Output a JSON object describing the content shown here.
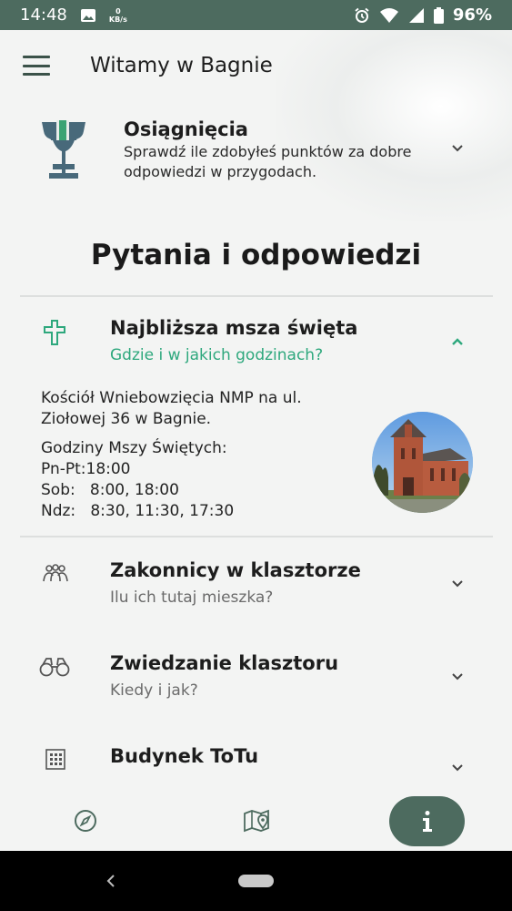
{
  "status_bar": {
    "time": "14:48",
    "speed_value": "0",
    "speed_unit": "KB/s",
    "battery": "96%"
  },
  "header": {
    "title": "Witamy w Bagnie"
  },
  "achievements": {
    "title": "Osiągnięcia",
    "description": "Sprawdź ile zdobyłeś punktów za dobre odpowiedzi w przygodach."
  },
  "section": {
    "heading": "Pytania i odpowiedzi"
  },
  "faq": [
    {
      "title": "Najbliższa msza święta",
      "subtitle": "Gdzie i w jakich godzinach?",
      "icon": "cross-icon",
      "expanded": true,
      "answer_address": "Kościół Wniebowzięcia NMP na ul.\nZiołowej 36 w Bagnie.",
      "answer_hours": "Godziny Mszy Świętych:\nPn-Pt:18:00\nSob:   8:00, 18:00\nNdz:   8:30, 11:30, 17:30"
    },
    {
      "title": "Zakonnicy w klasztorze",
      "subtitle": "Ilu ich tutaj mieszka?",
      "icon": "people-group-icon",
      "expanded": false
    },
    {
      "title": "Zwiedzanie klasztoru",
      "subtitle": "Kiedy i jak?",
      "icon": "binoculars-icon",
      "expanded": false
    },
    {
      "title": "Budynek ToTu",
      "subtitle": "",
      "icon": "building-icon",
      "expanded": false
    }
  ],
  "bottom_nav": {
    "items": [
      {
        "icon": "compass-icon",
        "active": false
      },
      {
        "icon": "map-pin-icon",
        "active": false
      },
      {
        "icon": "info-icon",
        "active": true
      }
    ]
  },
  "colors": {
    "status_bar": "#4d6b5f",
    "accent": "#2ea87d",
    "nav_active": "#4d6b5f"
  }
}
